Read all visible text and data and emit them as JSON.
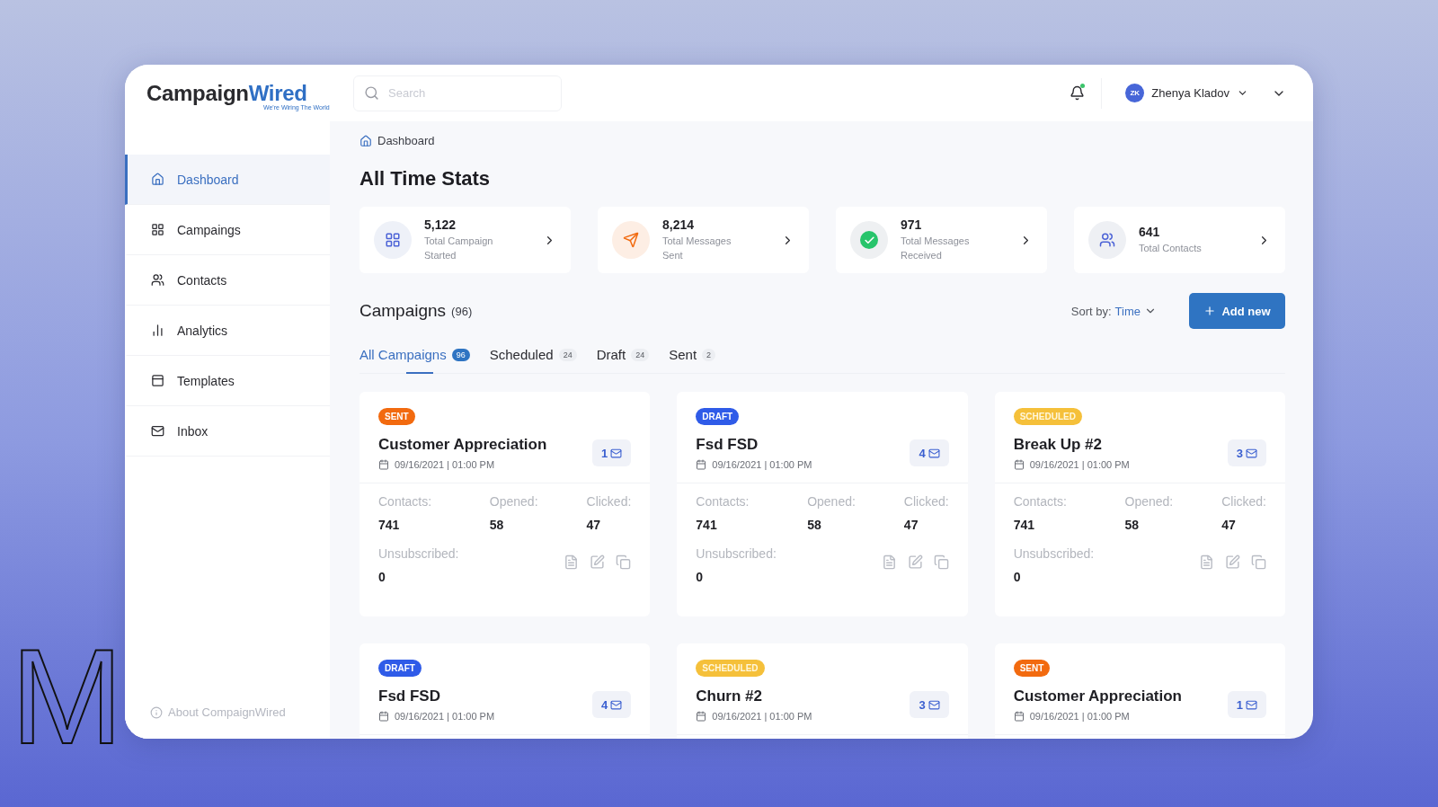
{
  "backdrop_title": "M",
  "brand": {
    "name": "Campaign",
    "name_accent": "Wired",
    "tagline": "We're Wiring The World"
  },
  "sidebar": {
    "items": [
      {
        "label": "Dashboard",
        "selected": true
      },
      {
        "label": "Campaings",
        "selected": false
      },
      {
        "label": "Contacts",
        "selected": false
      },
      {
        "label": "Analytics",
        "selected": false
      },
      {
        "label": "Templates",
        "selected": false
      },
      {
        "label": "Inbox",
        "selected": false
      }
    ],
    "footer": "About CompaignWired"
  },
  "search": {
    "placeholder": "Search"
  },
  "notifications": {
    "unread": true
  },
  "user": {
    "initials": "ZK",
    "name": "Zhenya Kladov"
  },
  "breadcrumb": "Dashboard",
  "stats_title": "All Time Stats",
  "stats": [
    {
      "value": "5,122",
      "label": "Total Campaign Started"
    },
    {
      "value": "8,214",
      "label": "Total Messages Sent"
    },
    {
      "value": "971",
      "label": "Total Messages Received"
    },
    {
      "value": "641",
      "label": "Total Contacts"
    }
  ],
  "campaigns": {
    "title": "Campaigns",
    "count": "(96)",
    "sort_label": "Sort by:",
    "sort_value": "Time",
    "add_button": "Add new",
    "tabs": [
      {
        "label": "All Campaigns",
        "count": "96",
        "selected": true
      },
      {
        "label": "Scheduled",
        "count": "24",
        "selected": false
      },
      {
        "label": "Draft",
        "count": "24",
        "selected": false
      },
      {
        "label": "Sent",
        "count": "2",
        "selected": false
      }
    ],
    "cards": [
      {
        "status": "SENT",
        "kind": "sent",
        "title": "Customer Appreciation",
        "date": "09/16/2021 | 01:00 PM",
        "messages": "1",
        "stats": [
          {
            "label": "Contacts:",
            "value": "741"
          },
          {
            "label": "Opened:",
            "value": "58"
          },
          {
            "label": "Clicked:",
            "value": "47"
          }
        ],
        "unsubscribed": {
          "label": "Unsubscribed:",
          "value": "0"
        }
      },
      {
        "status": "DRAFT",
        "kind": "draft",
        "title": "Fsd FSD",
        "date": "09/16/2021 | 01:00 PM",
        "messages": "4",
        "stats": [
          {
            "label": "Contacts:",
            "value": "741"
          },
          {
            "label": "Opened:",
            "value": "58"
          },
          {
            "label": "Clicked:",
            "value": "47"
          }
        ],
        "unsubscribed": {
          "label": "Unsubscribed:",
          "value": "0"
        }
      },
      {
        "status": "SCHEDULED",
        "kind": "scheduled",
        "title": "Break Up #2",
        "date": "09/16/2021 | 01:00 PM",
        "messages": "3",
        "stats": [
          {
            "label": "Contacts:",
            "value": "741"
          },
          {
            "label": "Opened:",
            "value": "58"
          },
          {
            "label": "Clicked:",
            "value": "47"
          }
        ],
        "unsubscribed": {
          "label": "Unsubscribed:",
          "value": "0"
        }
      },
      {
        "status": "DRAFT",
        "kind": "draft",
        "title": "Fsd FSD",
        "date": "09/16/2021 | 01:00 PM",
        "messages": "4"
      },
      {
        "status": "SCHEDULED",
        "kind": "scheduled",
        "title": "Churn #2",
        "date": "09/16/2021 | 01:00 PM",
        "messages": "3"
      },
      {
        "status": "SENT",
        "kind": "sent",
        "title": "Customer Appreciation",
        "date": "09/16/2021 | 01:00 PM",
        "messages": "1"
      }
    ]
  }
}
